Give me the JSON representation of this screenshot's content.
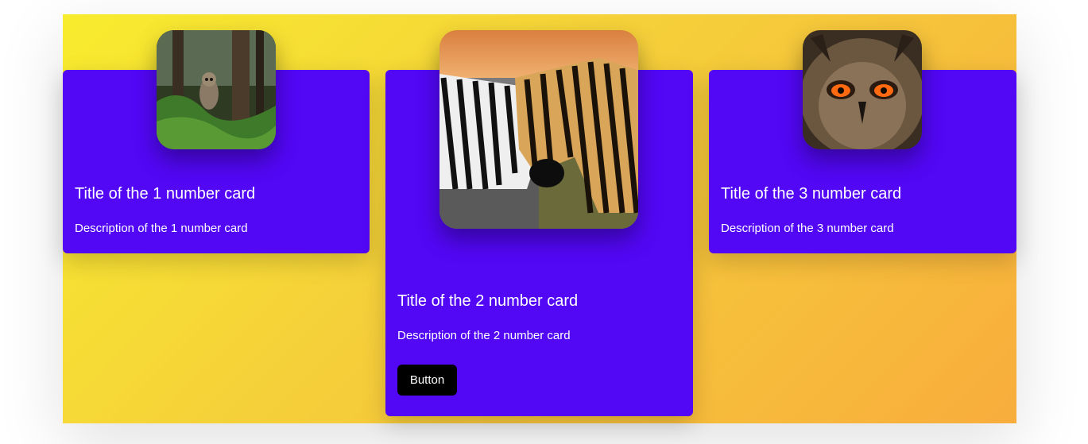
{
  "cards": [
    {
      "title": "Title of the 1 number card",
      "description": "Description of the 1 number card",
      "image_icon": "barred-owl-photo"
    },
    {
      "title": "Title of the 2 number card",
      "description": "Description of the 2 number card",
      "image_icon": "zebras-photo",
      "button_label": "Button"
    },
    {
      "title": "Title of the 3 number card",
      "description": "Description of the 3 number card",
      "image_icon": "eagle-owl-photo"
    }
  ],
  "colors": {
    "card_background": "#5207f5",
    "gradient_start": "#f8ec2e",
    "gradient_end": "#f8ad3c",
    "button_background": "#000000",
    "text": "#ffffff"
  }
}
